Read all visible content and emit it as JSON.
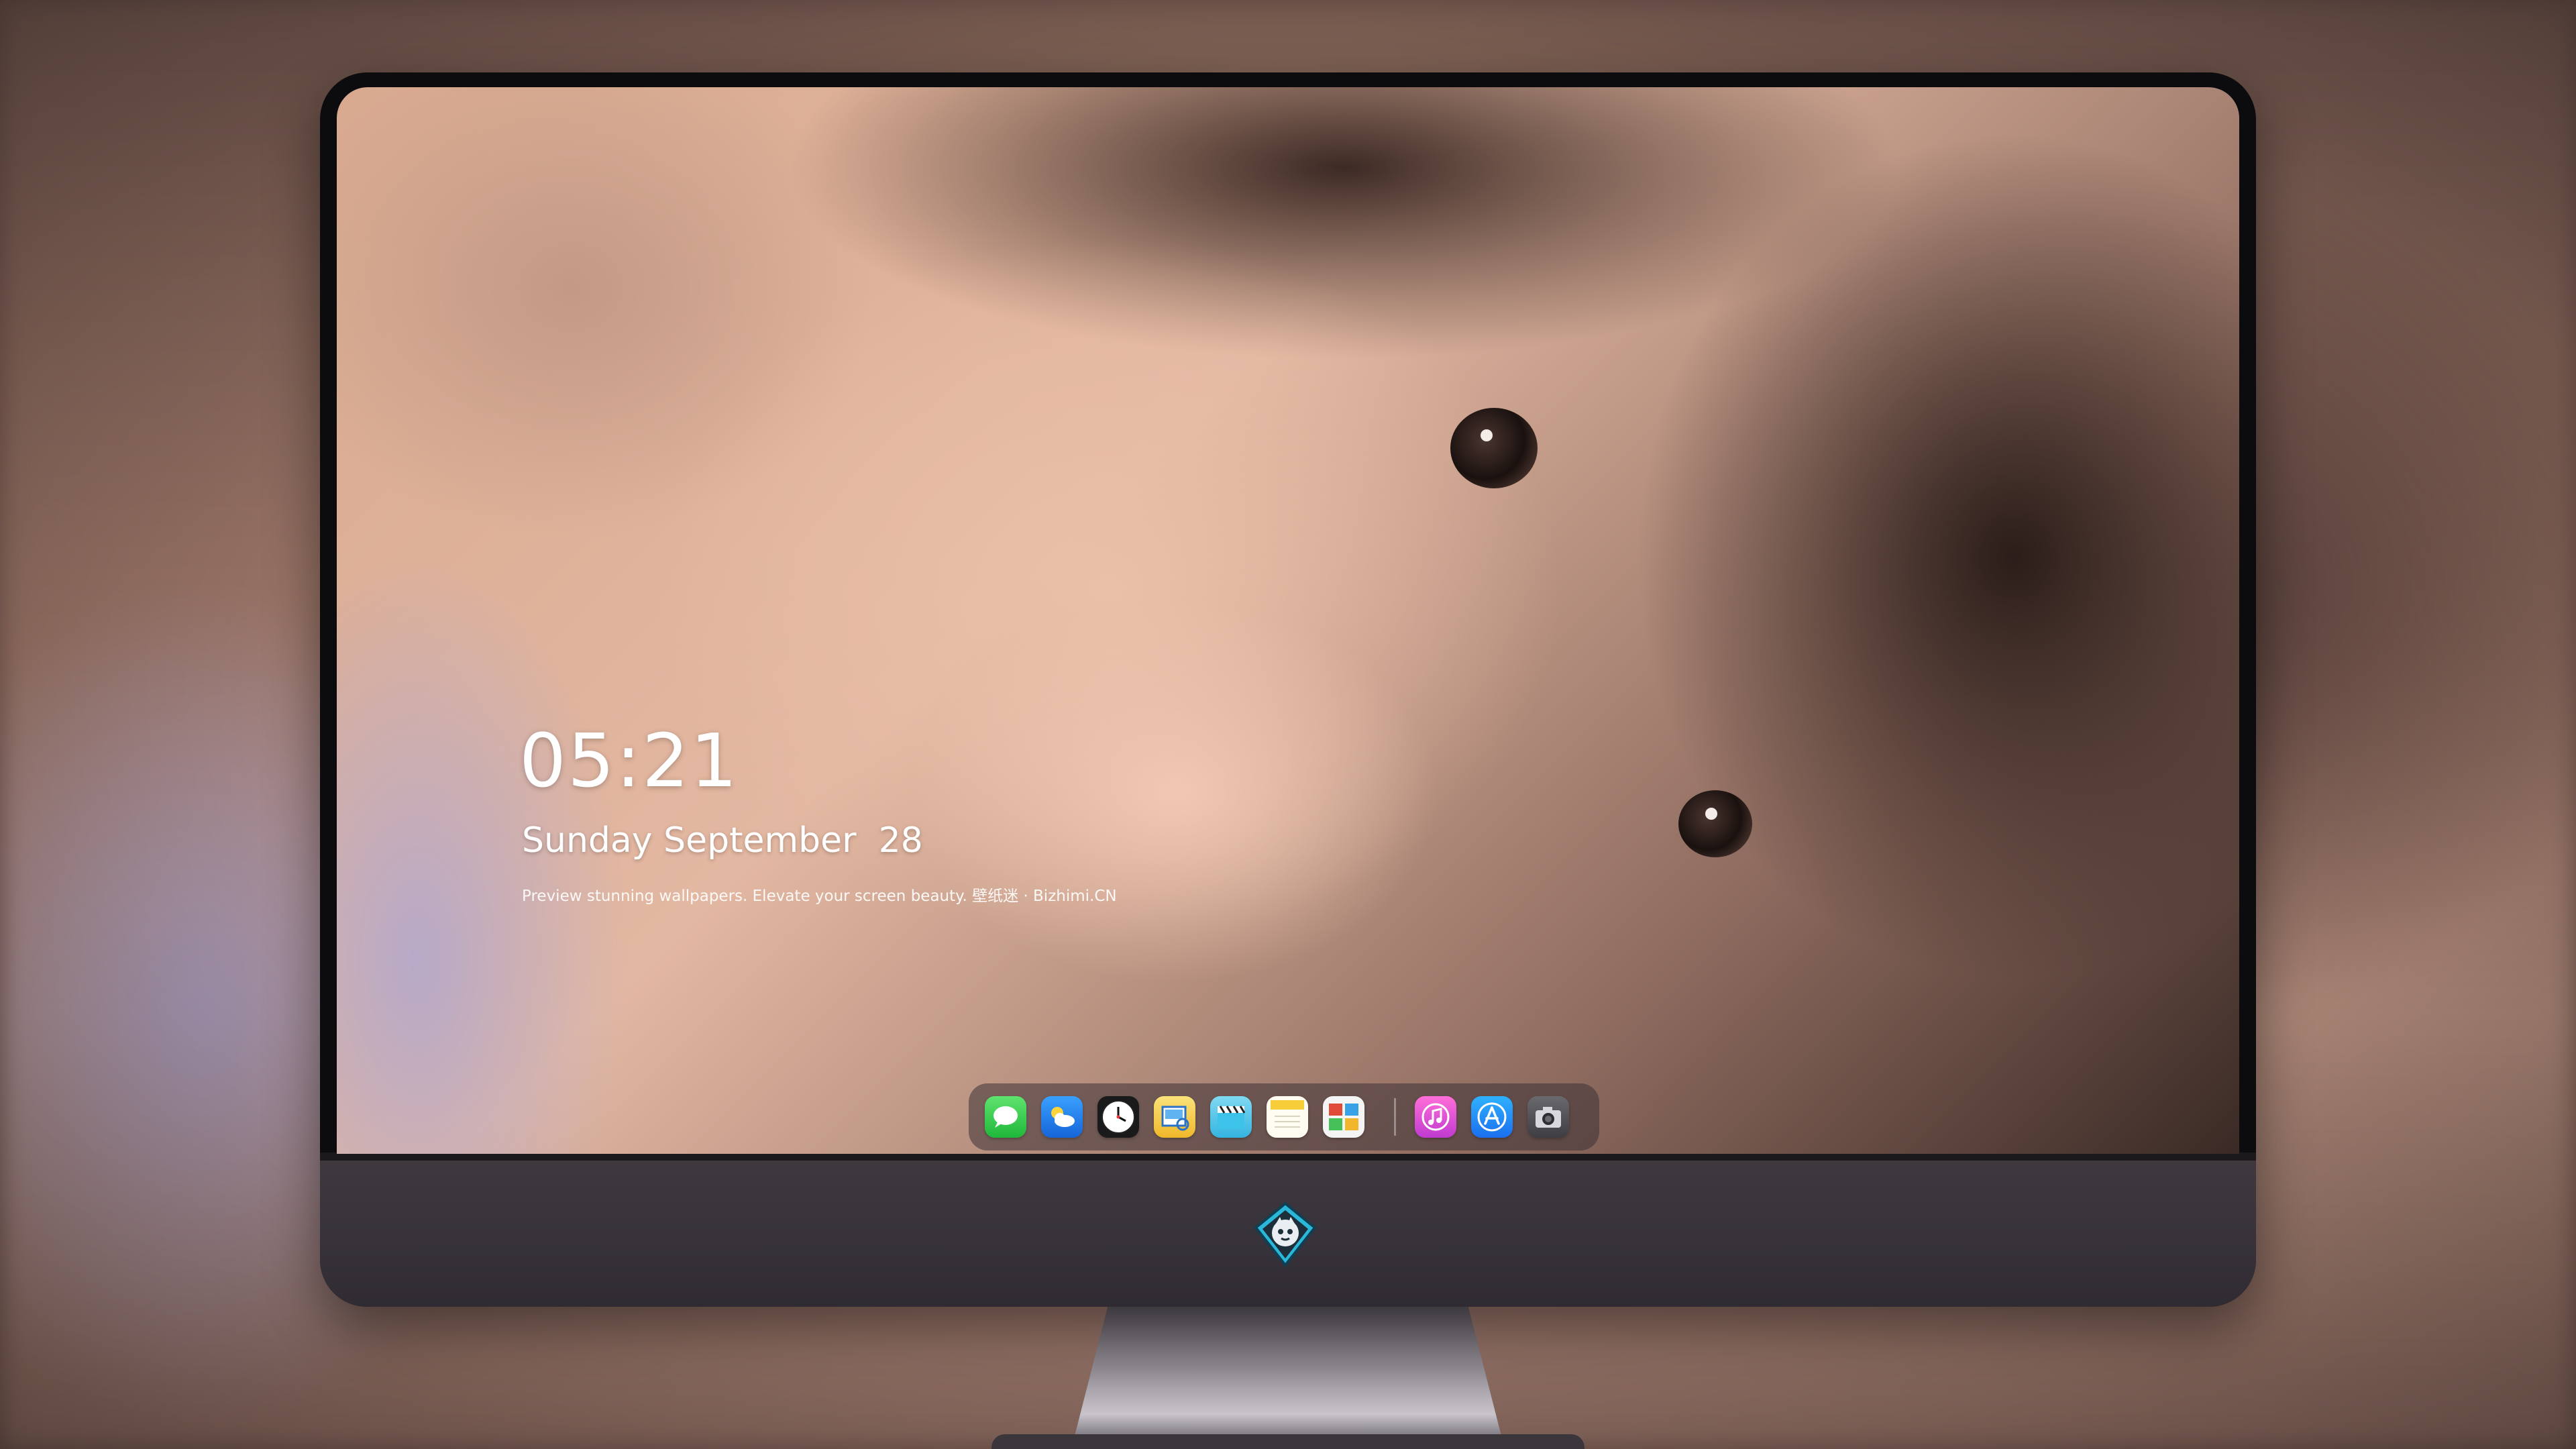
{
  "lock_screen": {
    "time": "05:21",
    "date": "Sunday September  28",
    "tagline": "Preview stunning wallpapers. Elevate your screen beauty. 壁纸迷 · Bizhimi.CN"
  },
  "dock": {
    "apps": [
      {
        "icon": "messages-icon",
        "color": "#2fc94a"
      },
      {
        "icon": "weather-icon",
        "color": "#2f8df5"
      },
      {
        "icon": "clock-icon",
        "color": "#ffffff"
      },
      {
        "icon": "preview-icon",
        "color": "#f2c230"
      },
      {
        "icon": "clips-icon",
        "color": "#58c8ea"
      },
      {
        "icon": "notes-icon",
        "color": "#f7d44a"
      },
      {
        "icon": "photo-booth-icon",
        "color": "#e05b3c"
      },
      {
        "icon": "music-icon",
        "color": "#e04bd6"
      },
      {
        "icon": "app-store-icon",
        "color": "#1e8ef5"
      },
      {
        "icon": "camera-icon",
        "color": "#555558"
      }
    ]
  },
  "colors": {
    "monitor_bezel": "#0c0c0e",
    "monitor_chin": "#3e393e",
    "clock_text": "#ffffff"
  }
}
